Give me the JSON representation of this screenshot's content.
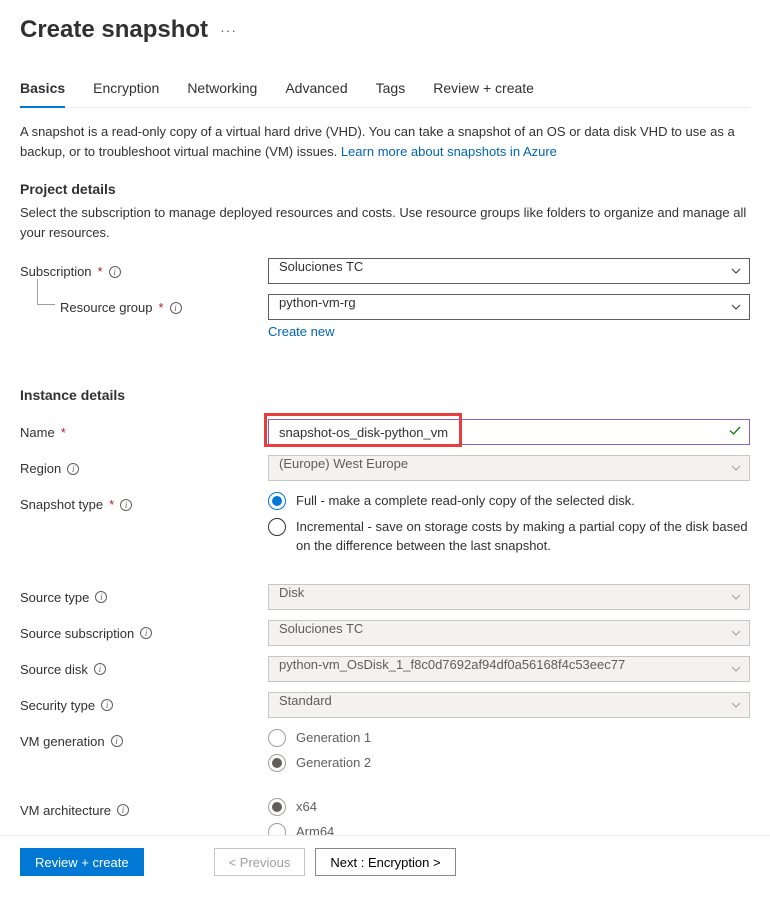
{
  "header": {
    "title": "Create snapshot"
  },
  "tabs": [
    "Basics",
    "Encryption",
    "Networking",
    "Advanced",
    "Tags",
    "Review + create"
  ],
  "active_tab_index": 0,
  "intro": {
    "text": "A snapshot is a read-only copy of a virtual hard drive (VHD). You can take a snapshot of an OS or data disk VHD to use as a backup, or to troubleshoot virtual machine (VM) issues.",
    "link_text": "Learn more about snapshots in Azure"
  },
  "project_details": {
    "title": "Project details",
    "desc": "Select the subscription to manage deployed resources and costs. Use resource groups like folders to organize and manage all your resources.",
    "subscription_label": "Subscription",
    "subscription_value": "Soluciones TC",
    "resource_group_label": "Resource group",
    "resource_group_value": "python-vm-rg",
    "create_new_link": "Create new"
  },
  "instance_details": {
    "title": "Instance details",
    "name_label": "Name",
    "name_value": "snapshot-os_disk-python_vm",
    "region_label": "Region",
    "region_value": "(Europe) West Europe",
    "snapshot_type_label": "Snapshot type",
    "snapshot_type_options": [
      "Full - make a complete read-only copy of the selected disk.",
      "Incremental - save on storage costs by making a partial copy of the disk based on the difference between the last snapshot."
    ],
    "snapshot_type_selected": 0,
    "source_type_label": "Source type",
    "source_type_value": "Disk",
    "source_subscription_label": "Source subscription",
    "source_subscription_value": "Soluciones TC",
    "source_disk_label": "Source disk",
    "source_disk_value": "python-vm_OsDisk_1_f8c0d7692af94df0a56168f4c53eec77",
    "security_type_label": "Security type",
    "security_type_value": "Standard",
    "vm_generation_label": "VM generation",
    "vm_generation_options": [
      "Generation 1",
      "Generation 2"
    ],
    "vm_generation_selected": 1,
    "vm_architecture_label": "VM architecture",
    "vm_architecture_options": [
      "x64",
      "Arm64"
    ],
    "vm_architecture_selected": 0
  },
  "footer": {
    "review_create": "Review + create",
    "previous": "< Previous",
    "next": "Next : Encryption >"
  }
}
